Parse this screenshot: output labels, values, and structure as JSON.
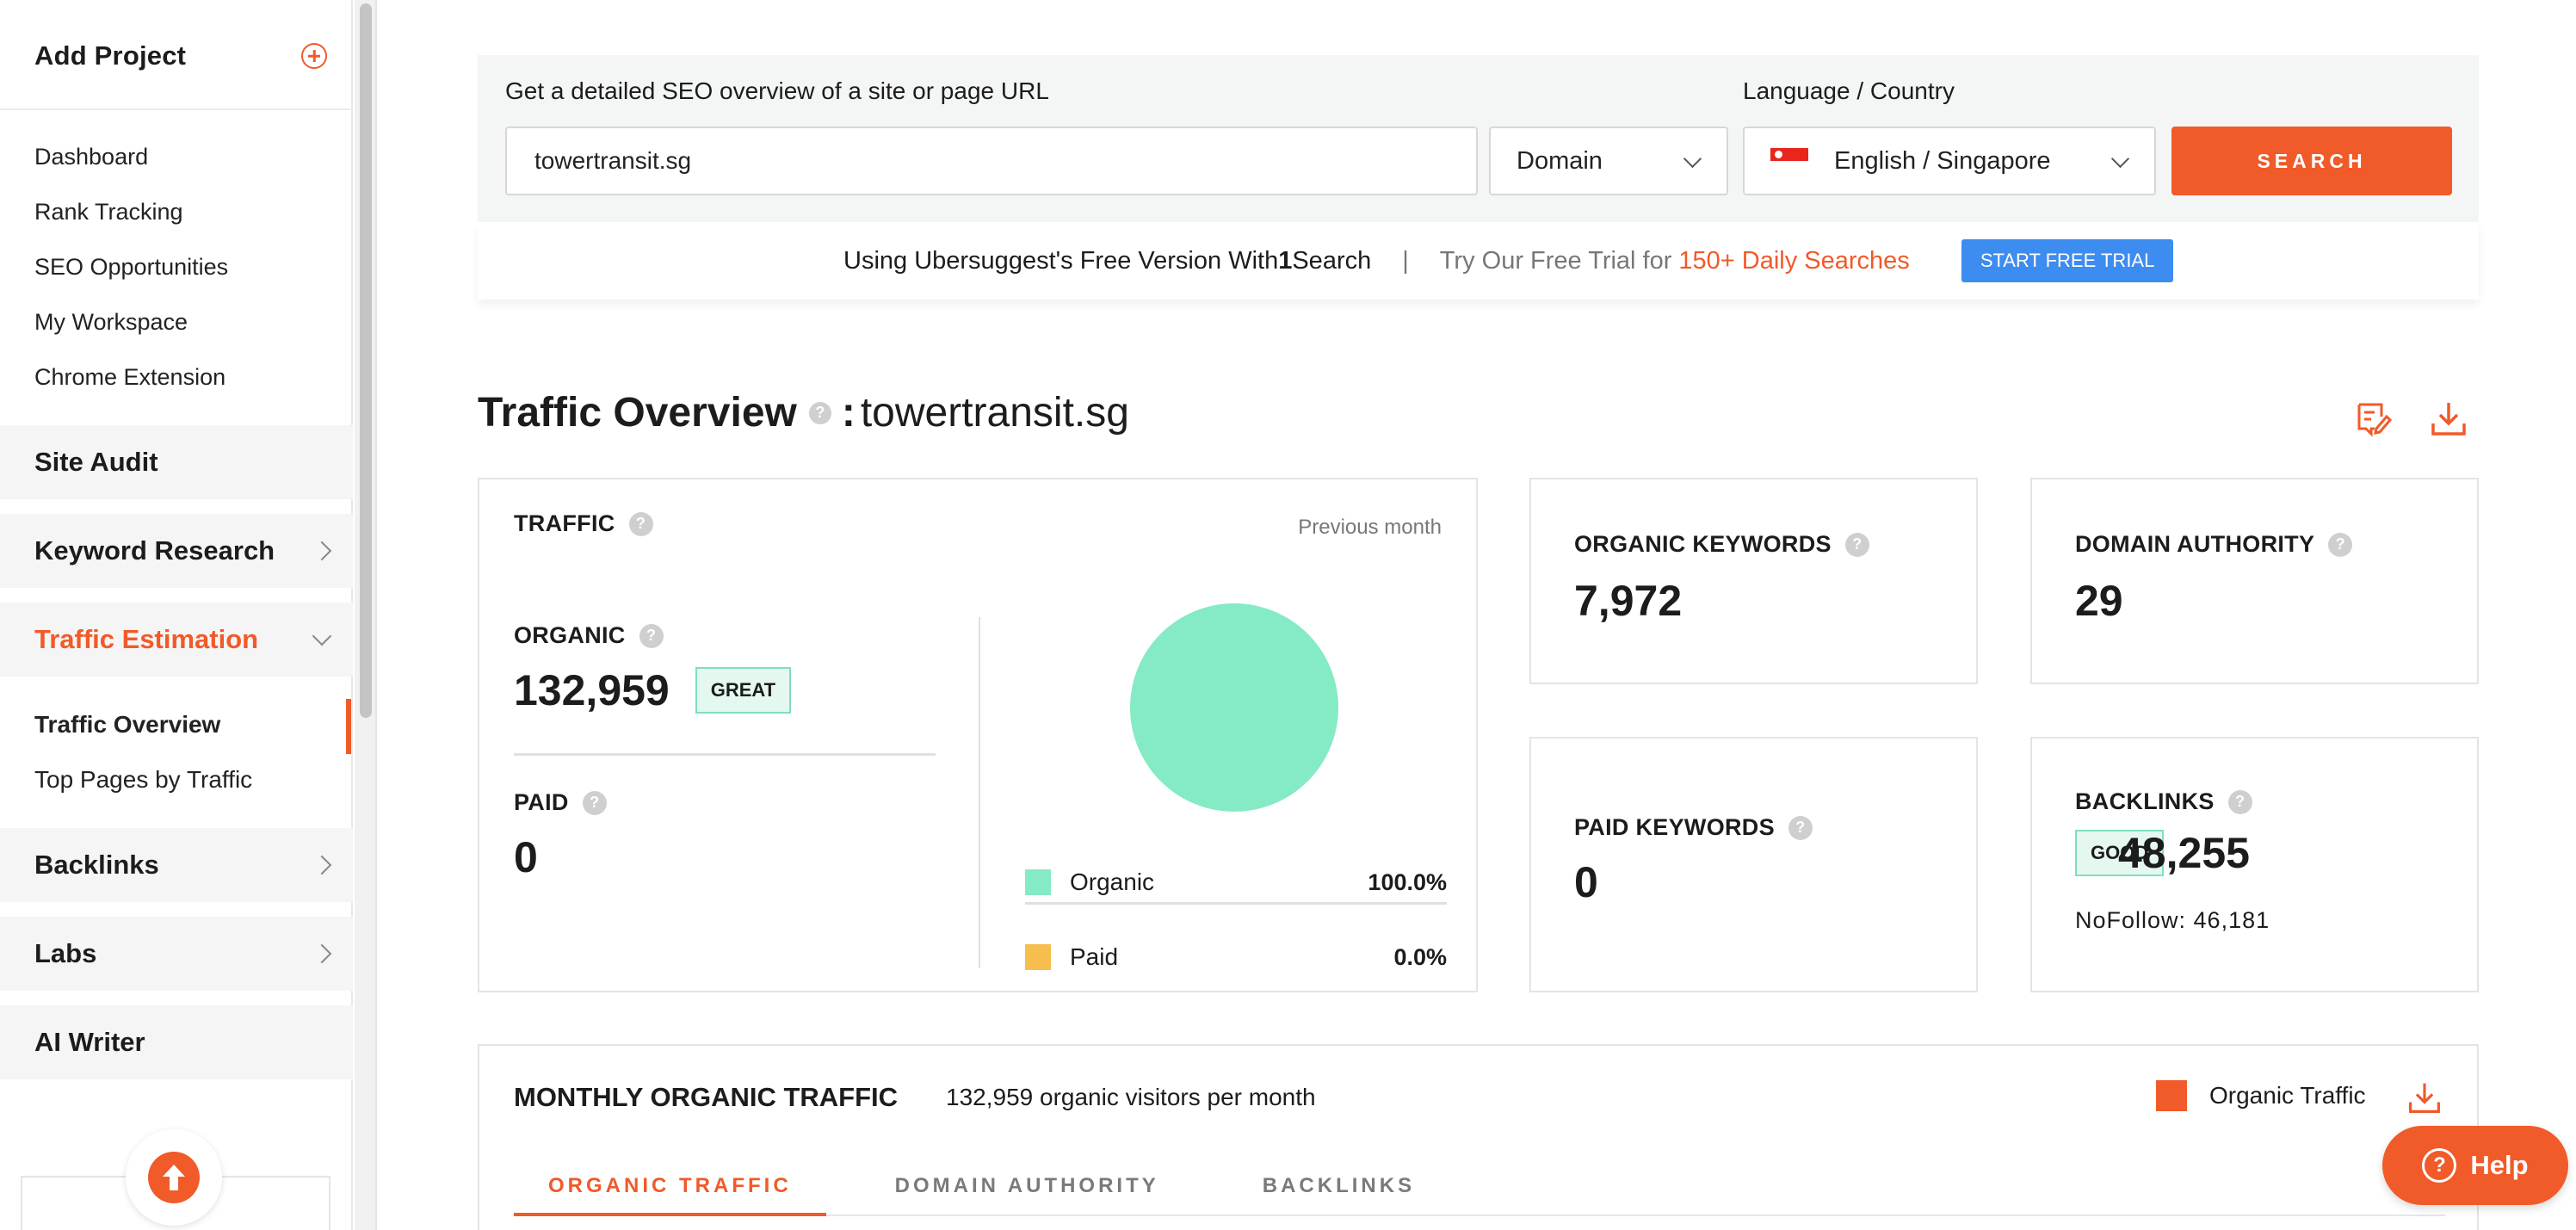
{
  "sidebar": {
    "add_project": "Add Project",
    "links": [
      "Dashboard",
      "Rank Tracking",
      "SEO Opportunities",
      "My Workspace",
      "Chrome Extension"
    ],
    "sections": {
      "site_audit": "Site Audit",
      "keyword_research": "Keyword Research",
      "traffic_estimation": "Traffic Estimation",
      "backlinks": "Backlinks",
      "labs": "Labs",
      "ai_writer": "AI Writer"
    },
    "traffic_sub": [
      "Traffic Overview",
      "Top Pages by Traffic"
    ]
  },
  "search": {
    "title": "Get a detailed SEO overview of a site or page URL",
    "lang_title": "Language / Country",
    "url_value": "towertransit.sg",
    "type_value": "Domain",
    "country_value": "English / Singapore",
    "button": "SEARCH"
  },
  "trial": {
    "prefix": "Using Ubersuggest's Free Version With ",
    "count": "1",
    "suffix": " Search",
    "sep": "|",
    "try": "Try Our Free Trial for",
    "highlight": "150+ Daily Searches",
    "button": "START FREE TRIAL"
  },
  "overview": {
    "title": "Traffic Overview",
    "colon": ":",
    "domain": "towertransit.sg"
  },
  "traffic": {
    "heading": "TRAFFIC",
    "period": "Previous month",
    "organic_label": "ORGANIC",
    "organic_value": "132,959",
    "organic_badge": "GREAT",
    "paid_label": "PAID",
    "paid_value": "0",
    "legend": [
      {
        "name": "Organic",
        "pct": "100.0%"
      },
      {
        "name": "Paid",
        "pct": "0.0%"
      }
    ]
  },
  "chart_data": {
    "type": "pie",
    "categories": [
      "Organic",
      "Paid"
    ],
    "values": [
      100.0,
      0.0
    ],
    "colors": [
      "#84ebc4",
      "#f6bd4f"
    ]
  },
  "metrics": {
    "organic_keywords": {
      "label": "ORGANIC KEYWORDS",
      "value": "7,972"
    },
    "domain_authority": {
      "label": "DOMAIN AUTHORITY",
      "value": "29"
    },
    "paid_keywords": {
      "label": "PAID KEYWORDS",
      "value": "0"
    },
    "backlinks": {
      "label": "BACKLINKS",
      "value": "48,255",
      "badge": "GOOD",
      "nofollow": "NoFollow: 46,181"
    }
  },
  "monthly": {
    "title": "MONTHLY ORGANIC TRAFFIC",
    "subtitle": "132,959 organic visitors per month",
    "legend": "Organic Traffic",
    "tabs": [
      "ORGANIC TRAFFIC",
      "DOMAIN AUTHORITY",
      "BACKLINKS"
    ]
  },
  "help": {
    "label": "Help",
    "q": "?"
  },
  "q_mark": "?",
  "colors": {
    "accent": "#f15a29",
    "organic": "#84ebc4",
    "paid": "#f6bd4f",
    "trial_button": "#3d8cf0"
  }
}
